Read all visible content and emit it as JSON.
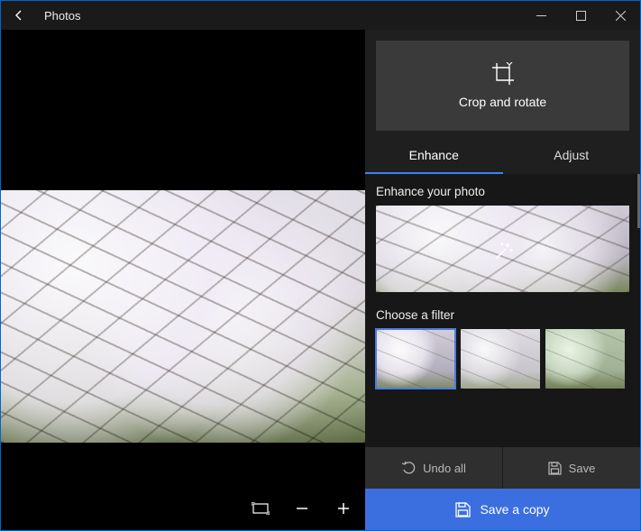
{
  "titlebar": {
    "app_title": "Photos"
  },
  "right": {
    "crop_label": "Crop and rotate",
    "tabs": {
      "enhance": "Enhance",
      "adjust": "Adjust"
    },
    "enhance_section": "Enhance your photo",
    "filter_section": "Choose a filter",
    "actions": {
      "undo": "Undo all",
      "save": "Save",
      "save_copy": "Save a copy"
    }
  }
}
